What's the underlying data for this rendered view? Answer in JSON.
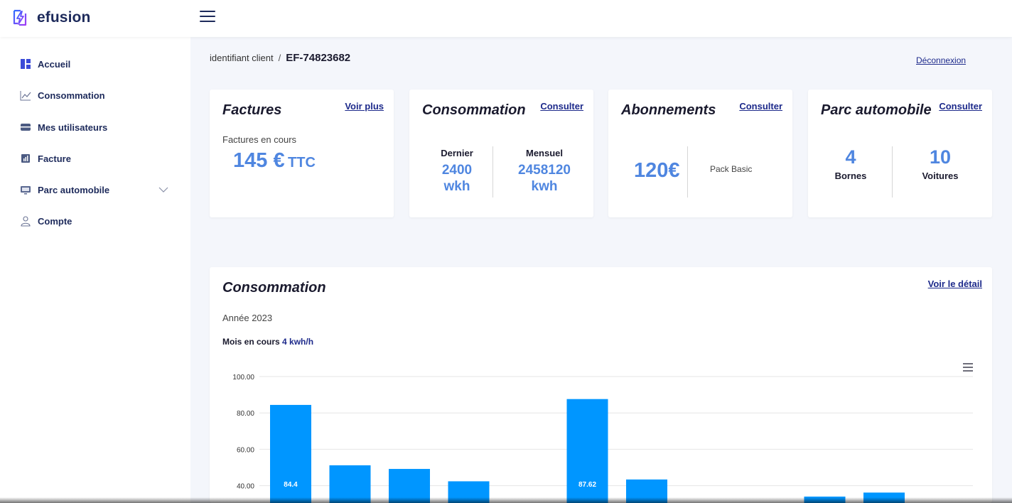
{
  "app": {
    "brand": "efusion"
  },
  "sidebar": {
    "items": [
      {
        "label": "Accueil",
        "icon": "dashboard-icon"
      },
      {
        "label": "Consommation",
        "icon": "line-chart-icon"
      },
      {
        "label": "Mes utilisateurs",
        "icon": "users-card-icon"
      },
      {
        "label": "Facture",
        "icon": "bar-chart-icon"
      },
      {
        "label": "Parc automobile",
        "icon": "monitor-icon",
        "expandable": true
      },
      {
        "label": "Compte",
        "icon": "user-icon"
      }
    ]
  },
  "header": {
    "breadcrumb_label": "identifiant client",
    "breadcrumb_sep": "/",
    "client_id": "EF-74823682",
    "logout": "Déconnexion"
  },
  "cards": {
    "factures": {
      "title": "Factures",
      "link": "Voir plus",
      "sub": "Factures en cours",
      "amount": "145 €",
      "suffix": "TTC"
    },
    "consommation": {
      "title": "Consommation",
      "link": "Consulter",
      "col1_label": "Dernier",
      "col1_value": "2400",
      "col1_unit": "wkh",
      "col2_label": "Mensuel",
      "col2_value": "2458120",
      "col2_unit": "kwh"
    },
    "abonnements": {
      "title": "Abonnements",
      "link": "Consulter",
      "price": "120€",
      "plan": "Pack Basic"
    },
    "parc": {
      "title": "Parc automobile",
      "link": "Consulter",
      "col1_value": "4",
      "col1_label": "Bornes",
      "col2_value": "10",
      "col2_label": "Voitures"
    }
  },
  "panel": {
    "title": "Consommation",
    "link": "Voir le détail",
    "year": "Année 2023",
    "month_label": "Mois en cours",
    "month_value": "4 kwh/h"
  },
  "chart_data": {
    "type": "bar",
    "color": "#0096ff",
    "y_ticks": [
      "100.00",
      "80.00",
      "60.00",
      "40.00"
    ],
    "ylim": [
      0,
      100
    ],
    "values": [
      84.4,
      51.2,
      49.2,
      42.4,
      null,
      87.62,
      43.4,
      null,
      null,
      34.0,
      36.2
    ],
    "data_labels": [
      "84.4",
      "",
      "",
      "",
      "",
      "87.62",
      "",
      "",
      "",
      "",
      ""
    ]
  }
}
